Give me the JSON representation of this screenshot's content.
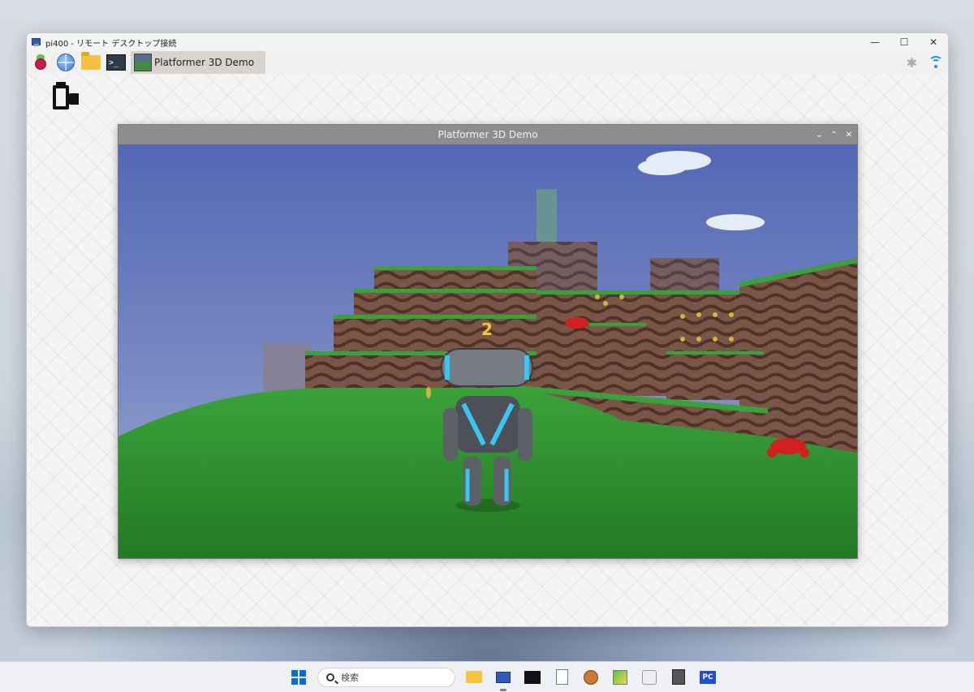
{
  "rdp_window": {
    "title": "pi400 - リモート デスクトップ接続",
    "minimize": "—",
    "maximize": "☐",
    "close": "✕"
  },
  "pi_panel": {
    "taskbar_button_label": "Platformer 3D Demo",
    "bluetooth_glyph": "✱"
  },
  "game_window": {
    "title": "Platformer 3D Demo",
    "controls": [
      "⌄",
      "⌃",
      "✕"
    ],
    "coin_count": "2"
  },
  "win_taskbar": {
    "search_placeholder": "検索",
    "pc_label": "PC"
  },
  "colors": {
    "sky_top": "#5569b8",
    "sky_bottom": "#98a8cc",
    "grass": "#2f8f2f",
    "dirt": "#6e4a3a",
    "robot_accent": "#39c6f0",
    "coin": "#f5c63b"
  }
}
